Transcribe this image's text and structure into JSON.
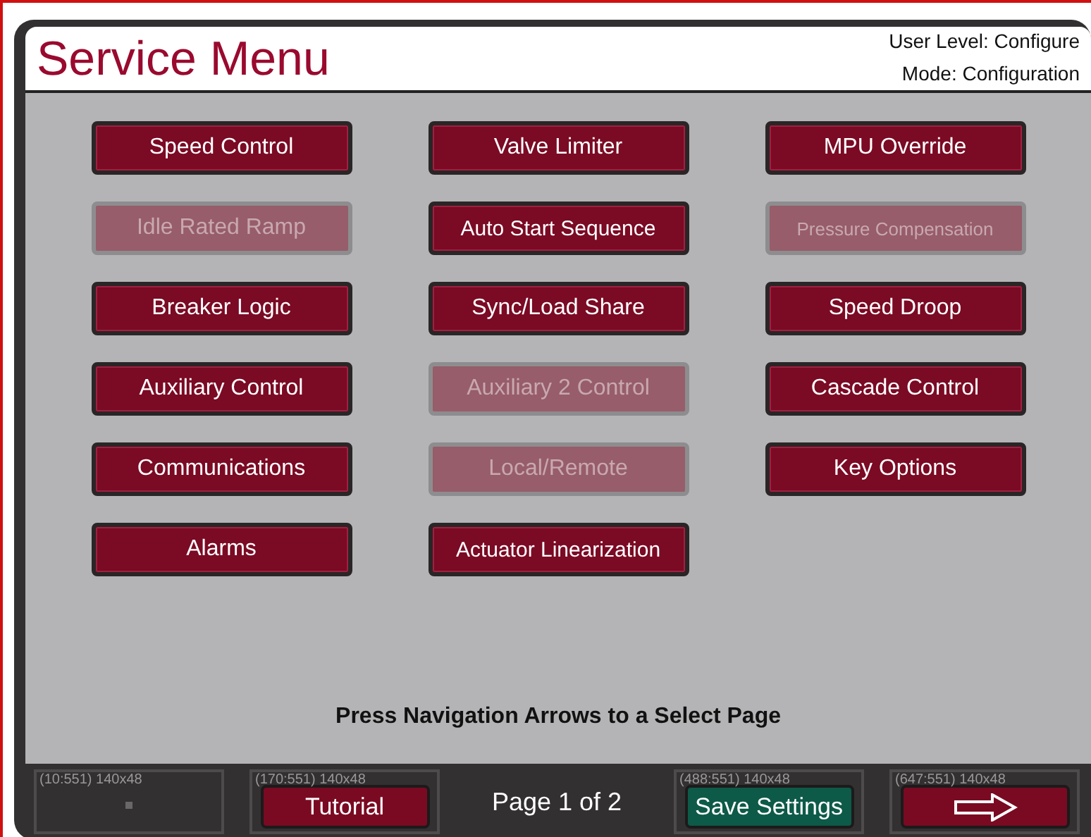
{
  "header": {
    "title": "Service Menu",
    "user_level": "User Level: Configure",
    "mode": "Mode: Configuration"
  },
  "menu_buttons": [
    {
      "label": "Speed Control",
      "disabled": false
    },
    {
      "label": "Valve Limiter",
      "disabled": false
    },
    {
      "label": "MPU Override",
      "disabled": false
    },
    {
      "label": "Idle Rated Ramp",
      "disabled": true
    },
    {
      "label": "Auto Start Sequence",
      "disabled": false
    },
    {
      "label": "Pressure Compensation",
      "disabled": true
    },
    {
      "label": "Breaker Logic",
      "disabled": false
    },
    {
      "label": "Sync/Load Share",
      "disabled": false
    },
    {
      "label": "Speed Droop",
      "disabled": false
    },
    {
      "label": "Auxiliary Control",
      "disabled": false
    },
    {
      "label": "Auxiliary 2 Control",
      "disabled": true
    },
    {
      "label": "Cascade Control",
      "disabled": false
    },
    {
      "label": "Communications",
      "disabled": false
    },
    {
      "label": "Local/Remote",
      "disabled": true
    },
    {
      "label": "Key Options",
      "disabled": false
    },
    {
      "label": "Alarms",
      "disabled": false
    },
    {
      "label": "Actuator Linearization",
      "disabled": false
    }
  ],
  "instruction": "Press Navigation Arrows to a Select Page",
  "footer": {
    "slots": [
      {
        "tag": "(10:551) 140x48",
        "kind": "empty"
      },
      {
        "tag": "(170:551) 140x48",
        "kind": "button",
        "label": "Tutorial",
        "color": "#7a0a22"
      },
      {
        "tag": "(488:551) 140x48",
        "kind": "button",
        "label": "Save Settings",
        "color": "#0d5a48"
      },
      {
        "tag": "(647:551) 140x48",
        "kind": "arrow",
        "color": "#7a0a22"
      }
    ],
    "page": "Page 1 of 2"
  }
}
